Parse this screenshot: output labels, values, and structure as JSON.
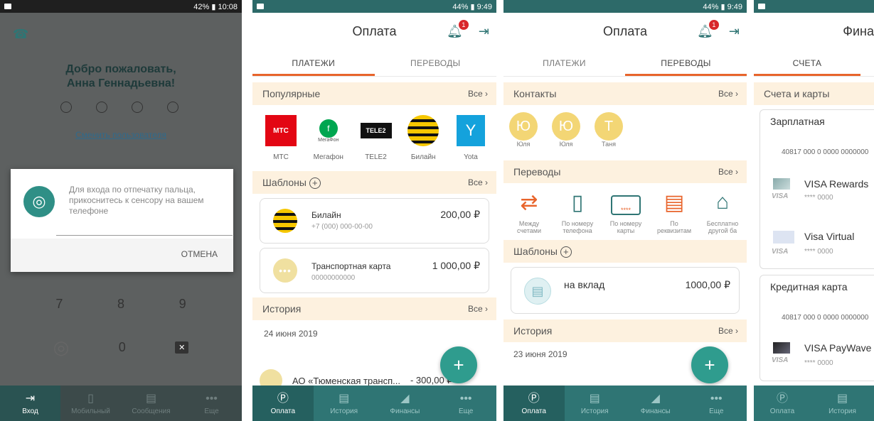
{
  "screen1": {
    "status": {
      "time": "10:08",
      "battery": "42%"
    },
    "welcome_line1": "Добро пожаловать,",
    "welcome_line2": "Анна Геннадьевна!",
    "change_user": "Сменить пользователя",
    "dialog": {
      "text": "Для входа по отпечатку пальца, прикоснитесь к сенсору на вашем телефоне",
      "cancel": "ОТМЕНА"
    },
    "keys": [
      "7",
      "8",
      "9",
      "0"
    ],
    "nav": [
      "Вход",
      "Мобильный",
      "Сообщения",
      "Еще"
    ]
  },
  "screen2": {
    "status": {
      "time": "9:49",
      "battery": "44%"
    },
    "title": "Оплата",
    "badge": "1",
    "tabs": [
      "ПЛАТЕЖИ",
      "ПЕРЕВОДЫ"
    ],
    "popular": {
      "title": "Популярные",
      "all": "Все"
    },
    "operators": [
      {
        "name": "МТС",
        "logo": "МТС"
      },
      {
        "name": "Мегафон",
        "logo": "МегаФон"
      },
      {
        "name": "TELE2",
        "logo": "TELE2"
      },
      {
        "name": "Билайн",
        "logo": ""
      },
      {
        "name": "Yota",
        "logo": "Y"
      }
    ],
    "templates": {
      "title": "Шаблоны",
      "all": "Все"
    },
    "cards": [
      {
        "name": "Билайн",
        "sub": "+7 (000) 000-00-00",
        "amount": "200,00 ₽"
      },
      {
        "name": "Транспортная карта",
        "sub": "00000000000",
        "amount": "1 000,00 ₽"
      }
    ],
    "history": {
      "title": "История",
      "all": "Все",
      "date": "24 июня 2019",
      "item": "АО «Тюменская трансп...",
      "item_amount": "- 300,00 ₽"
    },
    "nav": [
      "Оплата",
      "История",
      "Финансы",
      "Еще"
    ]
  },
  "screen3": {
    "status": {
      "time": "9:49",
      "battery": "44%"
    },
    "title": "Оплата",
    "badge": "1",
    "tabs": [
      "ПЛАТЕЖИ",
      "ПЕРЕВОДЫ"
    ],
    "contacts": {
      "title": "Контакты",
      "all": "Все"
    },
    "people": [
      {
        "initial": "Ю",
        "name": "Юля"
      },
      {
        "initial": "Ю",
        "name": "Юля"
      },
      {
        "initial": "Т",
        "name": "Таня"
      }
    ],
    "transfers": {
      "title": "Переводы",
      "all": "Все"
    },
    "transfer_types": [
      {
        "l1": "Между",
        "l2": "счетами"
      },
      {
        "l1": "По номеру",
        "l2": "телефона"
      },
      {
        "l1": "По номеру",
        "l2": "карты"
      },
      {
        "l1": "По",
        "l2": "реквизитам"
      },
      {
        "l1": "Бесплатно",
        "l2": "другой ба"
      }
    ],
    "templates": {
      "title": "Шаблоны"
    },
    "card": {
      "name": "на вклад",
      "amount": "1000,00 ₽"
    },
    "history": {
      "title": "История",
      "all": "Все",
      "date": "23 июня 2019"
    },
    "nav": [
      "Оплата",
      "История",
      "Финансы",
      "Еще"
    ]
  },
  "screen4": {
    "title": "Фина",
    "tab": "СЧЕТА",
    "section": "Счета и карты",
    "group1": {
      "title": "Зарплатная",
      "account": "40817 000 0 0000 0000000",
      "cards": [
        {
          "name": "VISA Rewards",
          "num": "**** 0000",
          "brand": "VISA"
        },
        {
          "name": "Visa Virtual",
          "num": "**** 0000",
          "brand": "VISA"
        }
      ]
    },
    "group2": {
      "title": "Кредитная карта",
      "account": "40817 000 0 0000 0000000",
      "cards": [
        {
          "name": "VISA PayWave",
          "num": "**** 0000",
          "brand": "VISA"
        }
      ]
    },
    "nav": [
      "Оплата",
      "История"
    ]
  },
  "colors": {
    "teal": "#2f7574",
    "accent": "#e8642b",
    "section_bg": "#fdf1df",
    "fab": "#2f9c8e"
  }
}
